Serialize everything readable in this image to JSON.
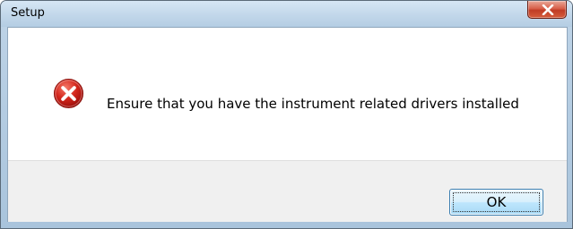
{
  "window": {
    "title": "Setup"
  },
  "titlebar": {
    "close_icon": "close-icon"
  },
  "dialog": {
    "icon": "error-icon",
    "message": "Ensure that you have the instrument related drivers installed"
  },
  "buttons": {
    "ok_label": "OK"
  },
  "colors": {
    "error_red": "#d3261c",
    "close_button": "#c9432c",
    "button_border": "#3c7fb1",
    "button_area": "#f0f0f0"
  }
}
